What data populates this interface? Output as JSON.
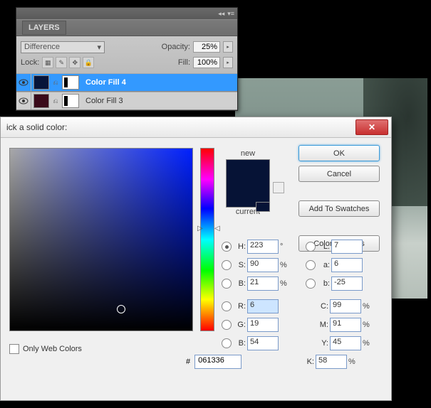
{
  "layers_panel": {
    "title": "LAYERS",
    "blend_mode": "Difference",
    "opacity_label": "Opacity:",
    "opacity_value": "25%",
    "lock_label": "Lock:",
    "fill_label": "Fill:",
    "fill_value": "100%",
    "rows": [
      {
        "name": "Color Fill 4",
        "swatch": "#06143a",
        "selected": true
      },
      {
        "name": "Color Fill 3",
        "swatch": "#3a0a1a",
        "selected": false
      }
    ]
  },
  "picker": {
    "title": "ick a solid color:",
    "new_label": "new",
    "current_label": "current",
    "buttons": {
      "ok": "OK",
      "cancel": "Cancel",
      "add_swatch": "Add To Swatches",
      "color_libs": "Color Libraries"
    },
    "hsb": {
      "H": "223",
      "S": "90",
      "B": "21"
    },
    "rgb": {
      "R": "6",
      "G": "19",
      "B": "54"
    },
    "lab": {
      "L": "7",
      "a": "6",
      "b": "-25"
    },
    "cmyk": {
      "C": "99",
      "M": "91",
      "Y": "45",
      "K": "58"
    },
    "hex": "061336",
    "web_only_label": "Only Web Colors",
    "deg": "°",
    "pct": "%"
  }
}
